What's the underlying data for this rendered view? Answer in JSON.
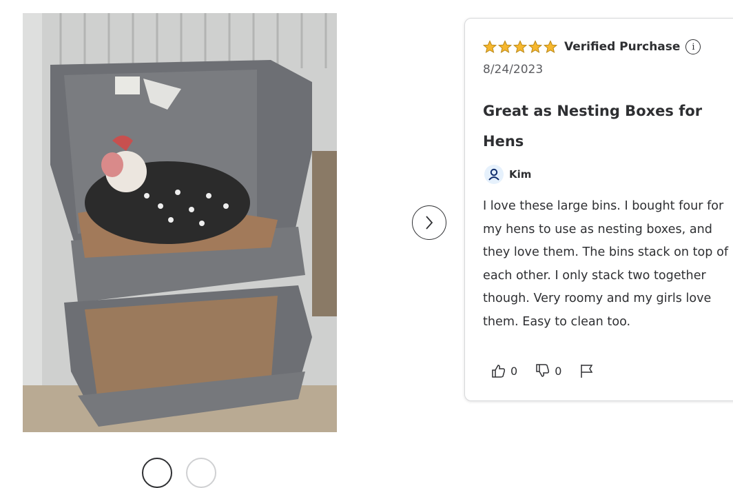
{
  "review": {
    "rating": 5,
    "rating_max": 5,
    "star_color": "#f6b72e",
    "verified_label": "Verified Purchase",
    "date": "8/24/2023",
    "title": "Great as Nesting Boxes for Hens",
    "author": "Kim",
    "body": "I love these large bins. I bought four for my hens to use as nesting boxes, and they love them. The bins stack on top of each other. I only stack two together though. Very roomy and my girls love them. Easy to clean too.",
    "helpful_count": "0",
    "unhelpful_count": "0"
  },
  "icons": {
    "info": "info-icon",
    "next": "chevron-right-icon",
    "avatar": "user-icon",
    "thumbs_up": "thumbs-up-icon",
    "thumbs_down": "thumbs-down-icon",
    "report": "flag-icon"
  },
  "colors": {
    "accent_blue": "#0071dc",
    "avatar_bg": "#e6f1fc",
    "text": "#2e2f32"
  }
}
